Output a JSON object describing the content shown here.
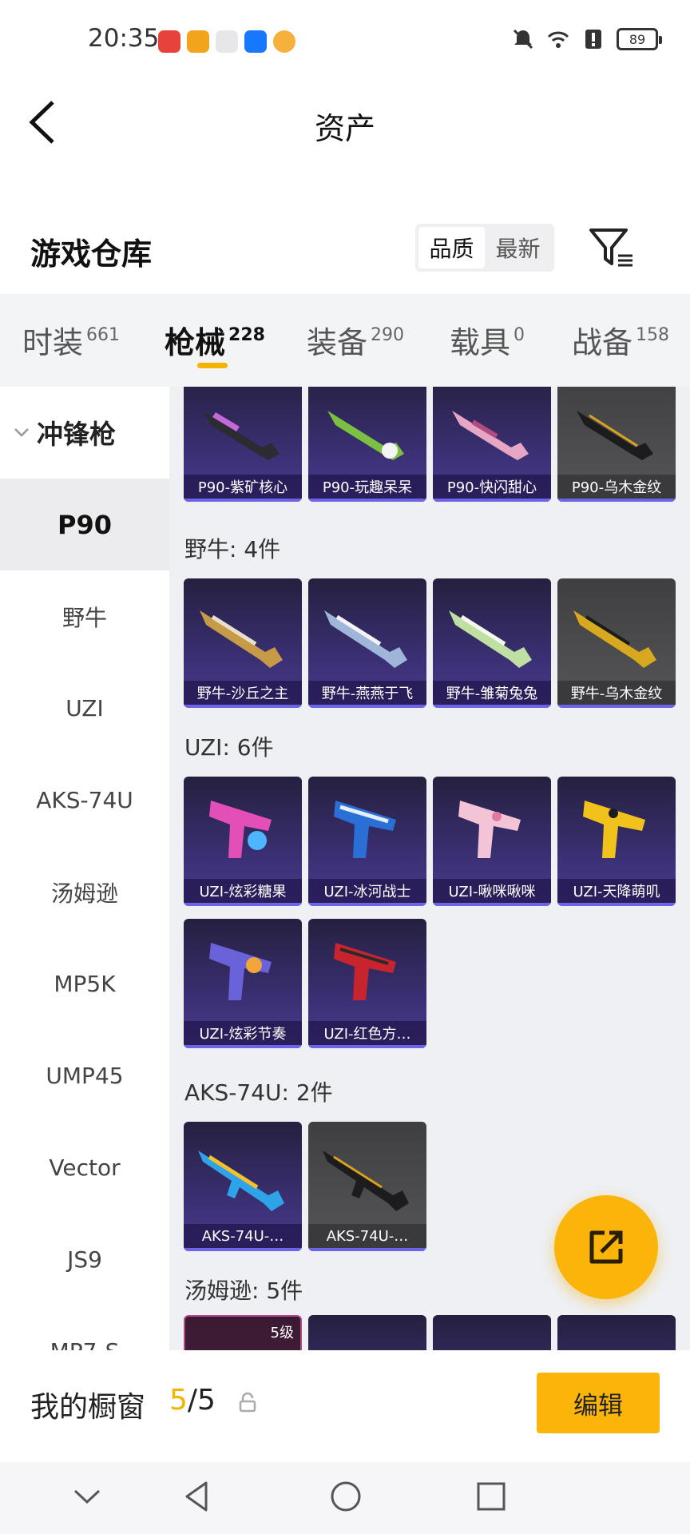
{
  "status_bar": {
    "time": "20:35",
    "battery": "89"
  },
  "header": {
    "title": "资产"
  },
  "section": {
    "title": "游戏仓库",
    "sort_options": [
      "品质",
      "最新"
    ]
  },
  "tabs": [
    {
      "label": "时装",
      "count": "661"
    },
    {
      "label": "枪械",
      "count": "228"
    },
    {
      "label": "装备",
      "count": "290"
    },
    {
      "label": "载具",
      "count": "0"
    },
    {
      "label": "战备",
      "count": "158"
    }
  ],
  "sidebar": {
    "header": "冲锋枪",
    "items": [
      "P90",
      "野牛",
      "UZI",
      "AKS-74U",
      "汤姆逊",
      "MP5K",
      "UMP45",
      "Vector",
      "JS9",
      "MP7-S"
    ]
  },
  "groups": {
    "p90": {
      "items": [
        "P90-紫矿核心",
        "P90-玩趣呆呆",
        "P90-快闪甜心",
        "P90-乌木金纹"
      ]
    },
    "bison": {
      "label": "野牛: 4件",
      "items": [
        "野牛-沙丘之主",
        "野牛-燕燕于飞",
        "野牛-雏菊兔兔",
        "野牛-乌木金纹"
      ]
    },
    "uzi": {
      "label": "UZI: 6件",
      "items": [
        "UZI-炫彩糖果",
        "UZI-冰河战士",
        "UZI-啾咪啾咪",
        "UZI-天降萌叽",
        "UZI-炫彩节奏",
        "UZI-红色方…"
      ]
    },
    "aks": {
      "label": "AKS-74U: 2件",
      "items": [
        "AKS-74U-…",
        "AKS-74U-…"
      ]
    },
    "thompson": {
      "label": "汤姆逊: 5件",
      "level": "5级"
    }
  },
  "bottom": {
    "label": "我的橱窗",
    "current": "5",
    "total": "/5",
    "edit": "编辑"
  },
  "colors": {
    "accent": "#fbb50a",
    "card_purple": "#3a2f72",
    "card_gray": "#4d4d50"
  }
}
